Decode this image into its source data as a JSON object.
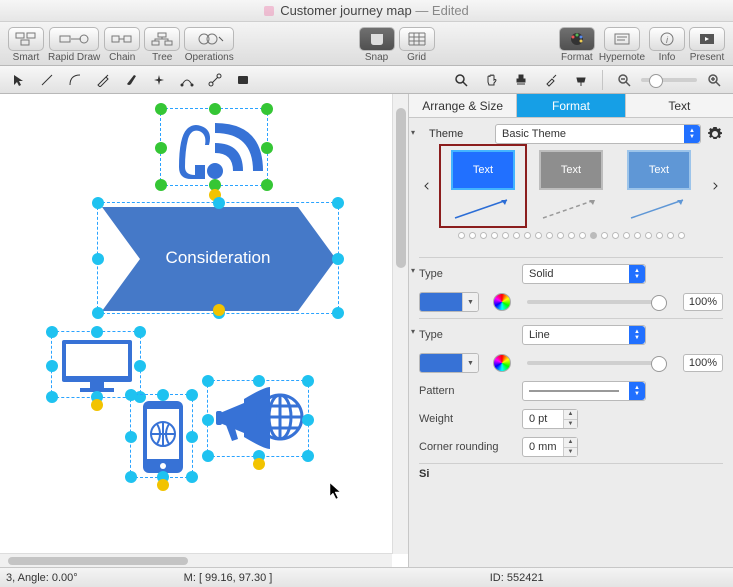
{
  "titlebar": {
    "document": "Customer journey map",
    "edited_label": "— Edited"
  },
  "toolbar": {
    "smart": "Smart",
    "rapid": "Rapid Draw",
    "chain": "Chain",
    "tree": "Tree",
    "operations": "Operations",
    "snap": "Snap",
    "grid": "Grid",
    "format": "Format",
    "hypernote": "Hypernote",
    "info": "Info",
    "present": "Present"
  },
  "tabs": {
    "arrange": "Arrange & Size",
    "format": "Format",
    "text": "Text"
  },
  "format_panel": {
    "theme_label": "Theme",
    "theme_value": "Basic Theme",
    "style_text": "Text",
    "fill": {
      "type_label": "Type",
      "type_value": "Solid",
      "opacity": "100%"
    },
    "line": {
      "type_label": "Type",
      "type_value": "Line",
      "opacity": "100%",
      "pattern_label": "Pattern",
      "weight_label": "Weight",
      "weight_value": "0 pt",
      "corner_label": "Corner rounding",
      "corner_value": "0 mm"
    },
    "si_label": "Si"
  },
  "canvas": {
    "consideration": "Consideration"
  },
  "status": {
    "angle": "3, Angle: 0.00°",
    "mouse": "M: [ 99.16, 97.30 ]",
    "id": "ID: 552421"
  },
  "colors": {
    "primary": "#3772d6",
    "accent": "#169fe6"
  }
}
